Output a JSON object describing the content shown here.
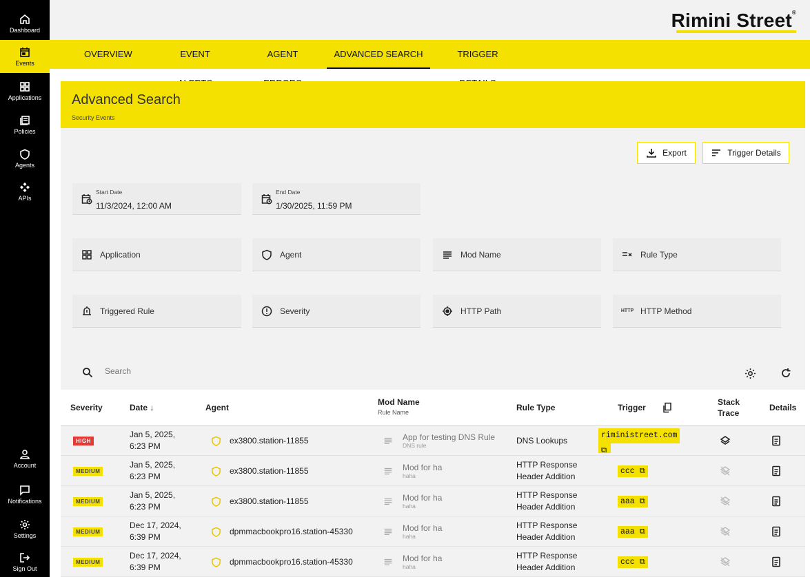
{
  "sidebar": {
    "top": [
      {
        "label": "Dashboard",
        "icon": "home-icon"
      },
      {
        "label": "Events",
        "icon": "calendar-icon",
        "active": true
      },
      {
        "label": "Applications",
        "icon": "grid-icon"
      },
      {
        "label": "Policies",
        "icon": "document-icon"
      },
      {
        "label": "Agents",
        "icon": "shield-icon"
      },
      {
        "label": "APIs",
        "icon": "api-icon"
      }
    ],
    "bottom": [
      {
        "label": "Account",
        "icon": "person-icon"
      },
      {
        "label": "Notifications",
        "icon": "chat-icon"
      },
      {
        "label": "Settings",
        "icon": "gear-icon"
      },
      {
        "label": "Sign Out",
        "icon": "signout-icon"
      }
    ]
  },
  "brand": {
    "name": "Rimini Street"
  },
  "tabs": [
    {
      "label": "OVERVIEW"
    },
    {
      "label": "EVENT ALERTS"
    },
    {
      "label": "AGENT ERRORS"
    },
    {
      "label": "ADVANCED SEARCH",
      "active": true
    },
    {
      "label": "TRIGGER DETAILS"
    }
  ],
  "page": {
    "title": "Advanced Search",
    "subtitle": "Security Events"
  },
  "actions": {
    "export": "Export",
    "trigger_details": "Trigger Details"
  },
  "dates": {
    "start_label": "Start Date",
    "start_value": "11/3/2024, 12:00 AM",
    "end_label": "End Date",
    "end_value": "1/30/2025, 11:59 PM"
  },
  "filters": {
    "application": "Application",
    "agent": "Agent",
    "mod_name": "Mod Name",
    "rule_type": "Rule Type",
    "triggered_rule": "Triggered Rule",
    "severity": "Severity",
    "http_path": "HTTP Path",
    "http_method": "HTTP Method"
  },
  "search": {
    "placeholder": "Search"
  },
  "table": {
    "headers": {
      "severity": "Severity",
      "date": "Date ↓",
      "agent": "Agent",
      "mod_name": "Mod Name",
      "rule_name": "Rule Name",
      "rule_type": "Rule Type",
      "trigger": "Trigger",
      "stack_trace_1": "Stack",
      "stack_trace_2": "Trace",
      "details": "Details"
    },
    "rows": [
      {
        "severity": "HIGH",
        "date1": "Jan 5, 2025,",
        "date2": "6:23 PM",
        "agent": "ex3800.station-11855",
        "mod": "App for testing DNS Rule",
        "rule": "DNS rule",
        "type1": "DNS Lookups",
        "type2": "",
        "trigger": "riministreet.com"
      },
      {
        "severity": "MEDIUM",
        "date1": "Jan 5, 2025,",
        "date2": "6:23 PM",
        "agent": "ex3800.station-11855",
        "mod": "Mod for ha",
        "rule": "haha",
        "type1": "HTTP Response",
        "type2": "Header Addition",
        "trigger": "ccc"
      },
      {
        "severity": "MEDIUM",
        "date1": "Jan 5, 2025,",
        "date2": "6:23 PM",
        "agent": "ex3800.station-11855",
        "mod": "Mod for ha",
        "rule": "haha",
        "type1": "HTTP Response",
        "type2": "Header Addition",
        "trigger": "aaa"
      },
      {
        "severity": "MEDIUM",
        "date1": "Dec 17, 2024,",
        "date2": "6:39 PM",
        "agent": "dpmmacbookpro16.station-45330",
        "mod": "Mod for ha",
        "rule": "haha",
        "type1": "HTTP Response",
        "type2": "Header Addition",
        "trigger": "aaa"
      },
      {
        "severity": "MEDIUM",
        "date1": "Dec 17, 2024,",
        "date2": "6:39 PM",
        "agent": "dpmmacbookpro16.station-45330",
        "mod": "Mod for ha",
        "rule": "haha",
        "type1": "HTTP Response",
        "type2": "Header Addition",
        "trigger": "ccc"
      }
    ]
  },
  "colors": {
    "accent": "#f5e100",
    "sidebar": "#000000",
    "high": "#e53935"
  }
}
